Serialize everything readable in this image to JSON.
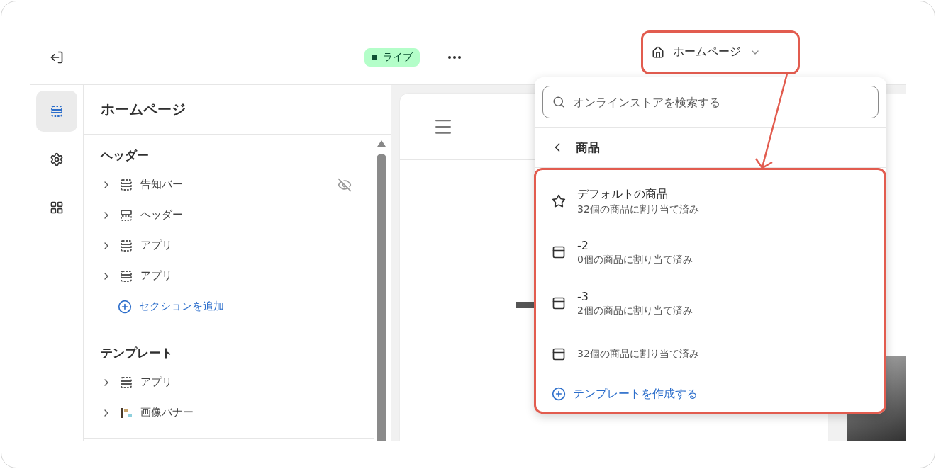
{
  "topbar": {
    "status": {
      "label": "ライブ",
      "color": "#0c5132"
    },
    "page_selector": {
      "label": "ホームページ"
    }
  },
  "rail": [
    {
      "kind": "sections",
      "selected": true
    },
    {
      "kind": "settings",
      "selected": false
    },
    {
      "kind": "apps",
      "selected": false
    }
  ],
  "sidebar": {
    "title": "ホームページ",
    "groups": [
      {
        "title": "ヘッダー",
        "items": [
          {
            "label": "告知バー",
            "kind": "section",
            "hidden": true
          },
          {
            "label": "ヘッダー",
            "kind": "header",
            "hidden": false
          },
          {
            "label": "アプリ",
            "kind": "section",
            "hidden": false
          },
          {
            "label": "アプリ",
            "kind": "section",
            "hidden": false
          }
        ],
        "add_label": "セクションを追加"
      },
      {
        "title": "テンプレート",
        "items": [
          {
            "label": "アプリ",
            "kind": "section",
            "hidden": false
          },
          {
            "label": "画像バナー",
            "kind": "image",
            "hidden": false
          }
        ]
      }
    ]
  },
  "dropdown": {
    "search": {
      "placeholder": "オンラインストアを検索する"
    },
    "back_label": "商品",
    "templates": [
      {
        "kind": "default",
        "title": "デフォルトの商品",
        "subtitle": "32個の商品に割り当て済み"
      },
      {
        "kind": "layout",
        "title": "-2",
        "subtitle": "0個の商品に割り当て済み"
      },
      {
        "kind": "layout",
        "title": "-3",
        "subtitle": "2個の商品に割り当て済み"
      },
      {
        "kind": "layout",
        "subtitle": "32個の商品に割り当て済み"
      }
    ],
    "create_label": "テンプレートを作成する"
  }
}
